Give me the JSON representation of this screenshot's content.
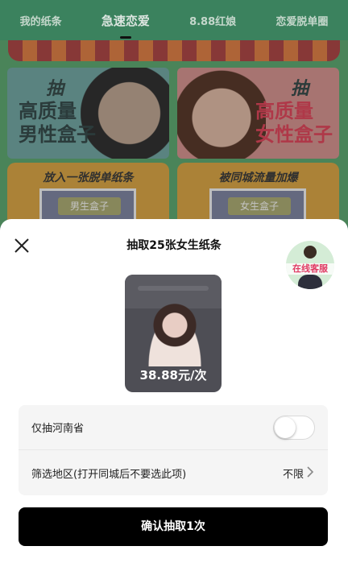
{
  "topnav": {
    "items": [
      "我的纸条",
      "急速恋爱",
      "8.88红娘",
      "恋爱脱单圈"
    ],
    "active_index": 1
  },
  "background": {
    "male_card": {
      "grab": "抽",
      "line1": "高质量",
      "line2": "男性盒子"
    },
    "female_card": {
      "grab": "抽",
      "line1": "高质量",
      "line2": "女性盒子"
    },
    "promo_left": {
      "text": "放入一张脱单纸条",
      "box": "男生盒子"
    },
    "promo_right": {
      "text": "被同城流量加爆",
      "box": "女生盒子"
    }
  },
  "sheet": {
    "title": "抽取25张女生纸条",
    "customer_service": "在线客服",
    "product": {
      "price": "38.88元/次"
    },
    "options": {
      "province_only_label": "仅抽河南省",
      "province_only_on": false,
      "region_label": "筛选地区(打开同城后不要选此项)",
      "region_value": "不限"
    },
    "confirm_label": "确认抽取1次"
  },
  "colors": {
    "nav_bg": "#3f8a64",
    "confirm_bg": "#000000",
    "cs_text": "#e03a63"
  },
  "icons": {
    "close": "close-icon",
    "chevron": "chevron-right-icon"
  }
}
